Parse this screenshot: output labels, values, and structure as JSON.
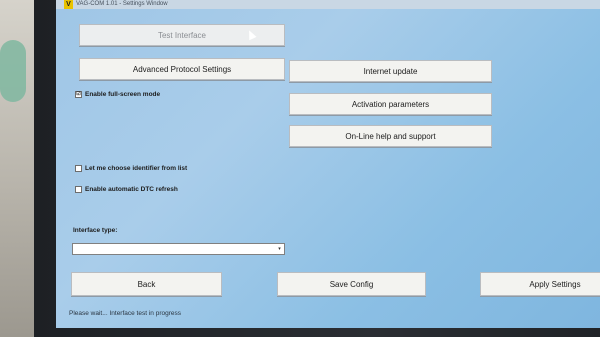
{
  "window": {
    "logo": "V",
    "title": "VAG-COM 1.01 - Settings Window"
  },
  "buttons": {
    "test_interface": "Test Interface",
    "advanced_protocol_settings": "Advanced Protocol Settings",
    "internet_update": "Internet update",
    "activation_parameters": "Activation parameters",
    "online_help": "On-Line help and support",
    "back": "Back",
    "save_config": "Save Config",
    "apply_settings": "Apply Settings"
  },
  "options": {
    "fullscreen": {
      "label": "Enable full-screen mode",
      "checked": true,
      "mark": "☑"
    },
    "choose_identifier": {
      "label": "Let me choose identifier from list",
      "checked": false,
      "mark": ""
    },
    "auto_dtc": {
      "label": "Enable automatic DTC refresh",
      "checked": false,
      "mark": ""
    }
  },
  "interface": {
    "label": "Interface type:",
    "value": "",
    "arrow": "▾"
  },
  "status": "Please wait... Interface test in progress"
}
